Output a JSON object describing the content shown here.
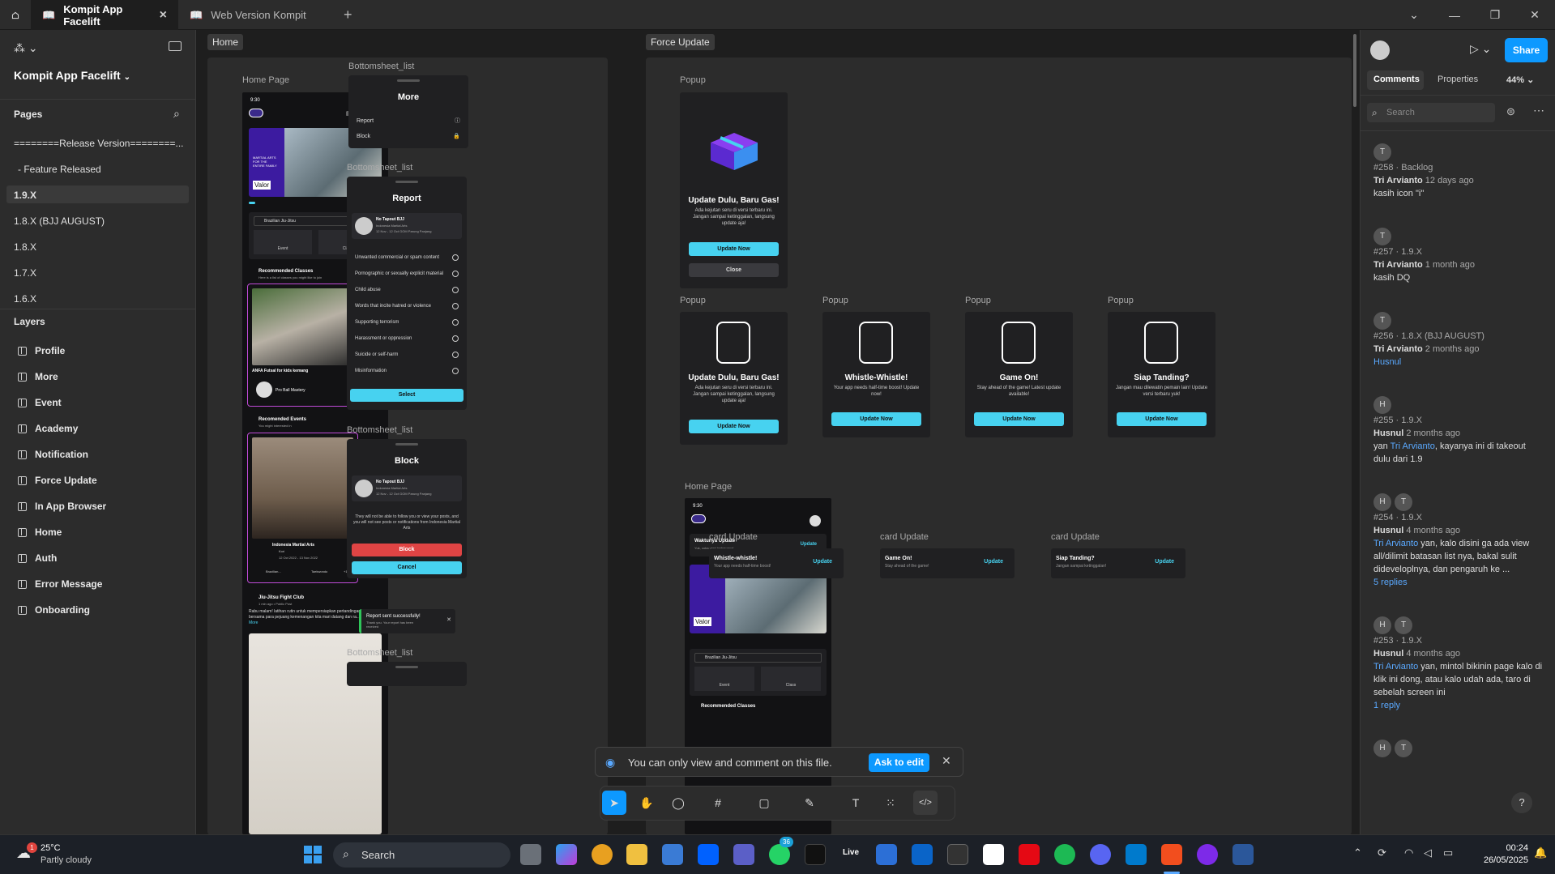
{
  "tabs": [
    {
      "label": "Kompit App Facelift"
    },
    {
      "label": "Web Version Kompit"
    }
  ],
  "left": {
    "project": "Kompit App Facelift",
    "pages_title": "Pages",
    "pages": [
      "========Release Version========...",
      "- Feature Released",
      "1.9.X",
      "1.8.X (BJJ AUGUST)",
      "1.8.X",
      "1.7.X",
      "1.6.X"
    ],
    "layers_title": "Layers",
    "layers": [
      "Profile",
      "More",
      "Event",
      "Academy",
      "Notification",
      "Force Update",
      "In App Browser",
      "Home",
      "Auth",
      "Error Message",
      "Onboarding"
    ]
  },
  "canvas": {
    "home_section": "Home",
    "force_section": "Force Update",
    "labels": {
      "home_page": "Home Page",
      "bs1": "Bottomsheet_list",
      "bs2": "Bottomsheet_list",
      "bs3": "Bottomsheet_list",
      "bs4": "Bottomsheet_list",
      "popup": "Popup",
      "home_page2": "Home Page",
      "card_update": "card Update"
    },
    "phone1": {
      "time": "9:30",
      "banner_text": "MARTIAL ARTS FOR THE ENTIRE FAMILY",
      "banner_brand": "Valor",
      "select": "Brazilian Jiu-Jitsu",
      "event": "Event",
      "class": "Class",
      "rec_classes": "Recommended Classes",
      "rec_classes_sub": "Here is a list of classes you might like to join",
      "class_name": "ANFA Futsal for kids kemang",
      "class_org": "Pro Ball Mastery",
      "rec_events": "Recomended Events",
      "rec_events_sub": "You might interested in",
      "event_name": "Indonesia Martial Arts",
      "event_org": "Kori",
      "event_date": "12 Oct 2022 - 13 Nov 2022",
      "tag1": "Brazilian...",
      "tag2": "Taekwondo",
      "tag_more": "+12",
      "post_name": "Jiu-Jitsu Fight Club",
      "post_meta": "1 min ago • Public Post",
      "post_text": "Rabu malam! latihan rutin untuk mempersiapkan pertandingan final bersama para pejuang kemenangan kita mari datang dan ra...",
      "read_more": "Read More"
    },
    "more_sheet": {
      "title": "More",
      "items": [
        "Report",
        "Block"
      ]
    },
    "report_sheet": {
      "title": "Report",
      "org_name": "No Tapout BJJ",
      "org_sub": "Indonesia Martial Arts",
      "org_meta": "12 Nov - 12 Oct  GOM Parung Panjang",
      "reasons": [
        "Unwanted commercial or spam content",
        "Pornographic or sexually explicit material",
        "Child abuse",
        "Words that incite hatred or violence",
        "Supporting terrorism",
        "Harassment or oppression",
        "Suicide or self-harm",
        "Misinformation"
      ],
      "select": "Select"
    },
    "block_sheet": {
      "title": "Block",
      "org_name": "No Tapout BJJ",
      "org_sub": "Indonesia Martial Arts",
      "org_meta": "12 Nov - 12 Oct  GOM Parung Panjang",
      "desc": "They will not be able to follow you or view your posts, and you will not see posts or notifications from Indonesia Martial Arts",
      "block": "Block",
      "cancel": "Cancel"
    },
    "toast": {
      "title": "Report sent successfully!",
      "desc": "Thank you. Your report has been received"
    },
    "popups": [
      {
        "title": "Update Dulu, Baru Gas!",
        "desc": "Ada kejutan seru di versi terbaru ini. Jangan sampai ketinggalan, langsung update aja!",
        "btn": "Update Now",
        "close": "Close"
      },
      {
        "title": "Update Dulu, Baru Gas!",
        "desc": "Ada kejutan seru di versi terbaru ini. Jangan sampai ketinggalan, langsung update aja!",
        "btn": "Update Now"
      },
      {
        "title": "Whistle-Whistle!",
        "desc": "Your app needs half-time boost! Update now!",
        "btn": "Update Now"
      },
      {
        "title": "Game On!",
        "desc": "Stay ahead of the game! Latest update available!",
        "btn": "Update Now"
      },
      {
        "title": "Siap Tanding?",
        "desc": "Jangan mau dilewatin pemain lain! Update versi terbaru yuk!",
        "btn": "Update Now"
      }
    ],
    "phone2": {
      "time": "9:30",
      "banner_title": "Waktunya Update",
      "banner_sub": "Yuk, coba versi terbarunya!",
      "update": "Update",
      "select": "Brazilian Jiu-Jitsu",
      "event": "Event",
      "class": "Class",
      "rec": "Recommended Classes"
    },
    "cards": [
      {
        "t": "Whistle-whistle!",
        "s": "Your app needs half-time boost!",
        "u": "Update"
      },
      {
        "t": "Game On!",
        "s": "Stay ahead of the game!",
        "u": "Update"
      },
      {
        "t": "Siap Tanding?",
        "s": "Jangan sampai ketinggalan!",
        "u": "Update"
      }
    ],
    "banner": {
      "text": "You can only view and comment on this file.",
      "btn": "Ask to edit"
    }
  },
  "right": {
    "tabs": [
      "Comments",
      "Properties"
    ],
    "zoom": "44%",
    "share": "Share",
    "search_placeholder": "Search",
    "comments": [
      {
        "avatars": [
          "T"
        ],
        "meta": "#258 · Backlog",
        "author": "Tri Arvianto",
        "time": "12 days ago",
        "text": "kasih icon \"i\""
      },
      {
        "avatars": [
          "T"
        ],
        "meta": "#257 · 1.9.X",
        "author": "Tri Arvianto",
        "time": "1 month ago",
        "text": "kasih DQ"
      },
      {
        "avatars": [
          "T"
        ],
        "meta": "#256 · 1.8.X (BJJ AUGUST)",
        "author": "Tri Arvianto",
        "time": "2 months ago",
        "mention": "Husnul"
      },
      {
        "avatars": [
          "H"
        ],
        "meta": "#255 · 1.9.X",
        "author": "Husnul",
        "time": "2 months ago",
        "pre": "yan",
        "mention": "Tri Arvianto",
        "text": ", kayanya ini di takeout dulu dari 1.9"
      },
      {
        "avatars": [
          "H",
          "T"
        ],
        "meta": "#254 · 1.9.X",
        "author": "Husnul",
        "time": "4 months ago",
        "mention": "Tri Arvianto",
        "text": "yan, kalo disini ga ada view all/dilimit batasan list nya, bakal sulit dideveloplnya, dan pengaruh ke ...",
        "replies": "5 replies"
      },
      {
        "avatars": [
          "H",
          "T"
        ],
        "meta": "#253 · 1.9.X",
        "author": "Husnul",
        "time": "4 months ago",
        "mention": "Tri Arvianto",
        "text": "yan, mintol bikinin page kalo di klik ini dong, atau kalo udah ada, taro di sebelah screen ini",
        "replies": "1 reply"
      },
      {
        "avatars": [
          "H",
          "T"
        ]
      }
    ]
  },
  "taskbar": {
    "temp": "25°C",
    "weather": "Partly cloudy",
    "search": "Search",
    "time": "00:24",
    "date": "26/05/2025",
    "badge1": "1",
    "badge2": "36",
    "live": "Live"
  }
}
